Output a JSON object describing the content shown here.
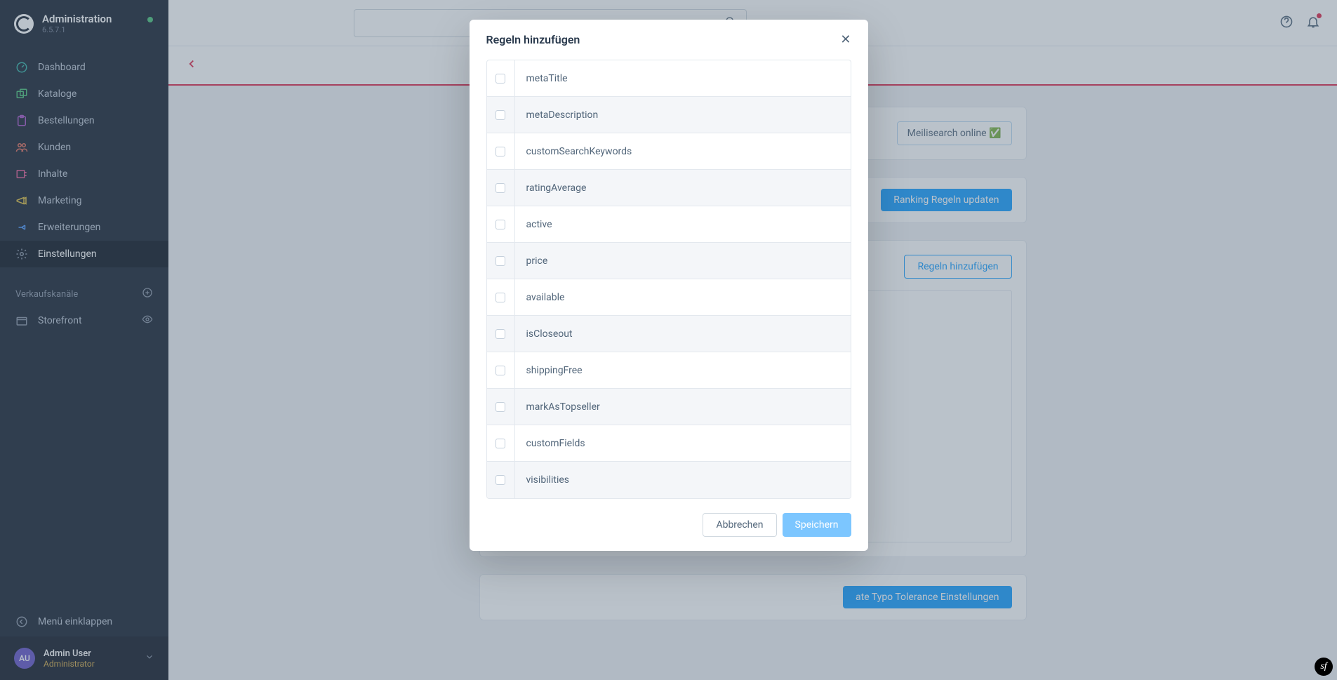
{
  "header": {
    "title": "Administration",
    "version": "6.5.7.1"
  },
  "nav": {
    "items": [
      {
        "label": "Dashboard",
        "icon": "gauge",
        "color": "#34b2a7"
      },
      {
        "label": "Kataloge",
        "icon": "catalog",
        "color": "#4bc27b"
      },
      {
        "label": "Bestellungen",
        "icon": "clipboard",
        "color": "#a855c9"
      },
      {
        "label": "Kunden",
        "icon": "users",
        "color": "#e9715e"
      },
      {
        "label": "Inhalte",
        "icon": "content",
        "color": "#de5a91"
      },
      {
        "label": "Marketing",
        "icon": "megaphone",
        "color": "#e0c042"
      },
      {
        "label": "Erweiterungen",
        "icon": "plug",
        "color": "#4f9bff"
      },
      {
        "label": "Einstellungen",
        "icon": "gear",
        "color": "#8994a6",
        "active": true
      }
    ],
    "section_label": "Verkaufskanäle",
    "channels": [
      {
        "label": "Storefront"
      }
    ],
    "collapse_label": "Menü einklappen"
  },
  "user": {
    "initials": "AU",
    "name": "Admin User",
    "role": "Administrator"
  },
  "page": {
    "status_button": "Meilisearch online ✅",
    "ranking_button": "Ranking Regeln updaten",
    "rules_add_button": "Regeln hinzufügen",
    "typo_button": "ate Typo Tolerance Einstellungen"
  },
  "modal": {
    "title": "Regeln hinzufügen",
    "rules": [
      "metaTitle",
      "metaDescription",
      "customSearchKeywords",
      "ratingAverage",
      "active",
      "price",
      "available",
      "isCloseout",
      "shippingFree",
      "markAsTopseller",
      "customFields",
      "visibilities"
    ],
    "cancel_label": "Abbrechen",
    "save_label": "Speichern"
  }
}
